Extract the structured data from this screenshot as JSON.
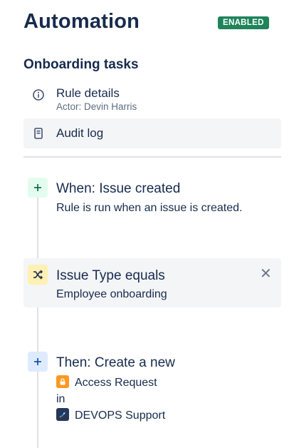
{
  "header": {
    "title": "Automation",
    "status_badge": "ENABLED"
  },
  "rule": {
    "name": "Onboarding tasks",
    "menu": [
      {
        "label": "Rule details",
        "sub": "Actor: Devin Harris",
        "icon": "info-icon"
      },
      {
        "label": "Audit log",
        "icon": "document-icon"
      }
    ]
  },
  "steps": {
    "trigger": {
      "title": "When: Issue created",
      "description": "Rule is run when an issue is created.",
      "icon": "plus-icon"
    },
    "condition": {
      "title": "Issue Type equals",
      "value": "Employee onboarding",
      "icon": "shuffle-icon"
    },
    "action": {
      "title": "Then: Create a new",
      "issue_type": "Access Request",
      "connector": "in",
      "project": "DEVOPS Support",
      "icon": "plus-icon"
    }
  },
  "colors": {
    "badge": "#1f845a",
    "trigger_tile": "#e3fcef",
    "condition_tile": "#fff0b3",
    "action_tile": "#deebff",
    "issue_type_icon": "#ff991f",
    "project_icon": "#253858"
  }
}
